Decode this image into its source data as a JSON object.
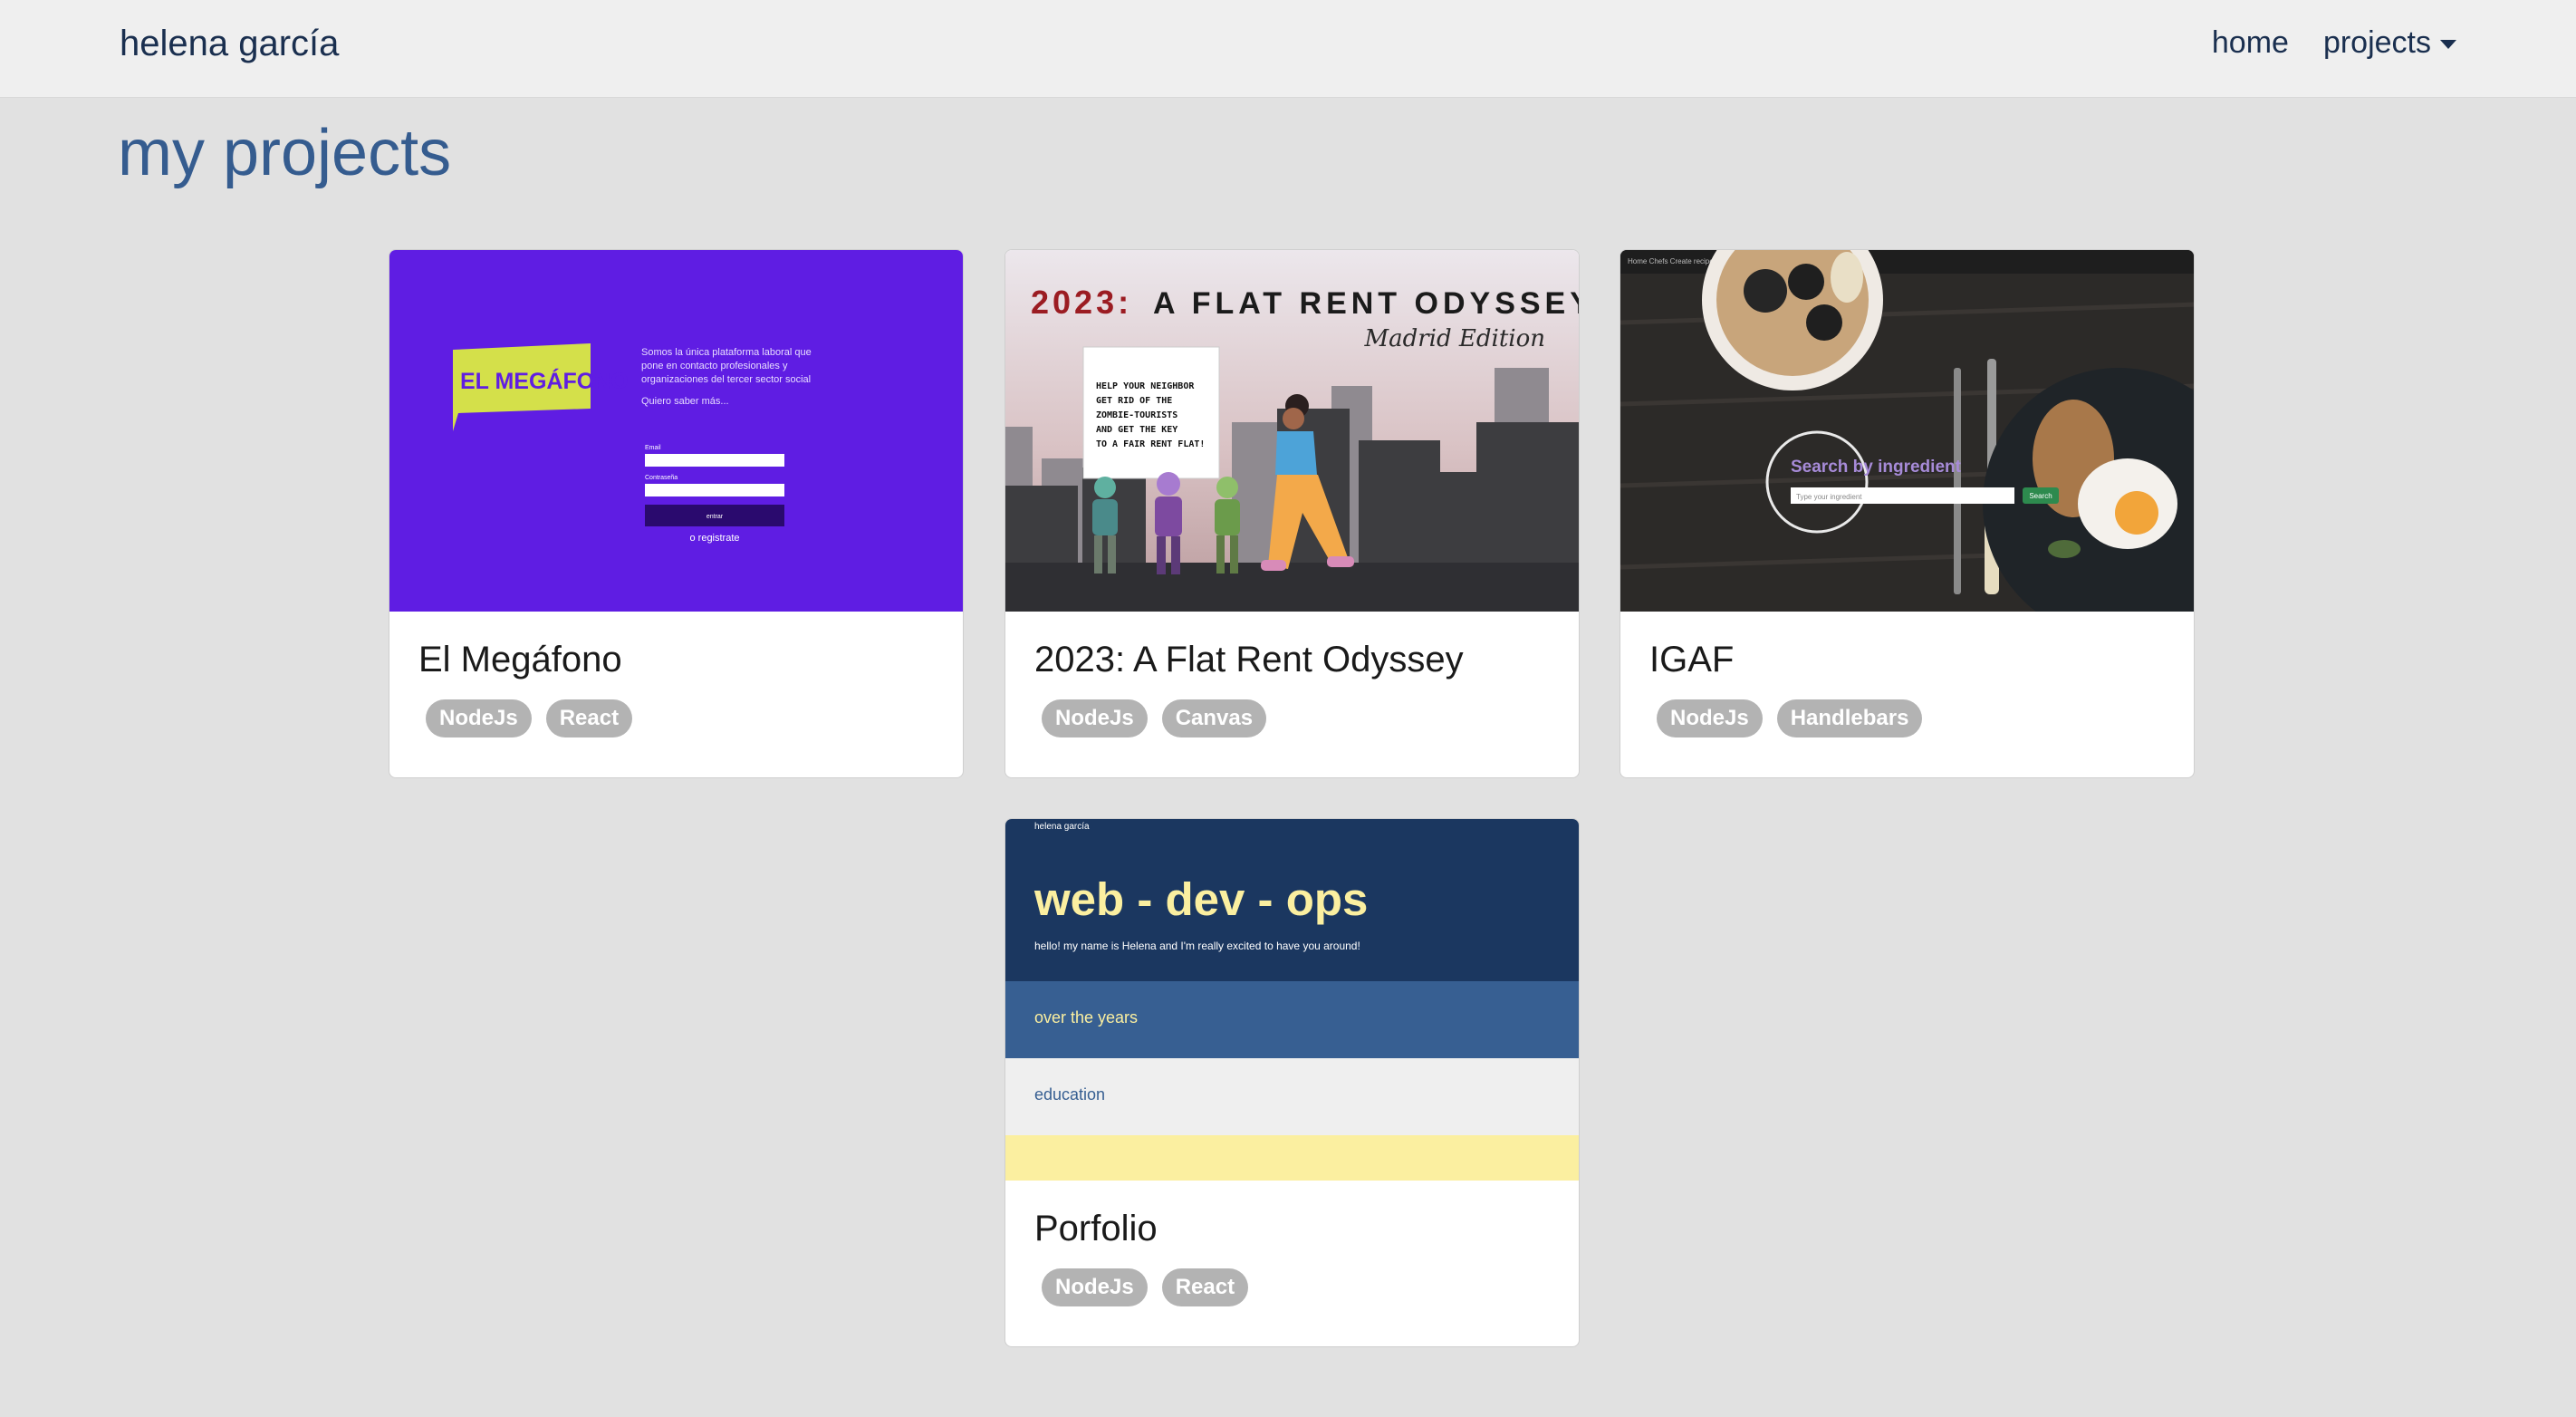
{
  "navbar": {
    "brand": "helena garcía",
    "links": [
      {
        "label": "home"
      },
      {
        "label": "projects"
      }
    ]
  },
  "page": {
    "title": "my projects"
  },
  "projects": [
    {
      "title": "El Megáfono",
      "tags": [
        "NodeJs",
        "React"
      ],
      "thumb": {
        "logo_text": "EL MEGÁFONO",
        "blurb_lines": [
          "Somos la única plataforma laboral que",
          "pone en contacto profesionales y",
          "organizaciones del tercer sector social"
        ],
        "more_link": "Quiero saber más...",
        "email_label": "Email",
        "password_label": "Contraseña",
        "submit_label": "entrar",
        "register_link": "o registrate"
      }
    },
    {
      "title": "2023: A Flat Rent Odyssey",
      "tags": [
        "NodeJs",
        "Canvas"
      ],
      "thumb": {
        "heading_accent": "2023:",
        "heading_rest": "A FLAT RENT ODYSSEY",
        "edition": "Madrid Edition",
        "sign_lines": [
          "HELP YOUR NEIGHBOR",
          "GET RID OF THE",
          "ZOMBIE-TOURISTS",
          "AND GET THE KEY",
          "TO A FAIR RENT FLAT!"
        ]
      }
    },
    {
      "title": "IGAF",
      "tags": [
        "NodeJs",
        "Handlebars"
      ],
      "thumb": {
        "search_title": "Search by ingredient",
        "search_placeholder": "Type your ingredient",
        "search_button": "Search",
        "menu_text": "Home   Chefs   Create recipes   Welcome ▾"
      }
    },
    {
      "title": "Porfolio",
      "tags": [
        "NodeJs",
        "React"
      ],
      "thumb": {
        "brand": "helena garcía",
        "hero": "web - dev - ops",
        "intro": "hello! my name is Helena and I'm really excited to have you around!",
        "section1": "over the years",
        "section2": "education"
      }
    }
  ],
  "colors": {
    "background": "#e1e1e1",
    "navbar": "#efefef",
    "title_blue": "#355c8f",
    "tag_grey": "#b3b3b3",
    "megafono_purple": "#5f1de3",
    "megafono_yellow": "#d4e04a",
    "porfolio_navy": "#1b3760",
    "porfolio_mid": "#375f92",
    "porfolio_yellow": "#fbefa0"
  }
}
